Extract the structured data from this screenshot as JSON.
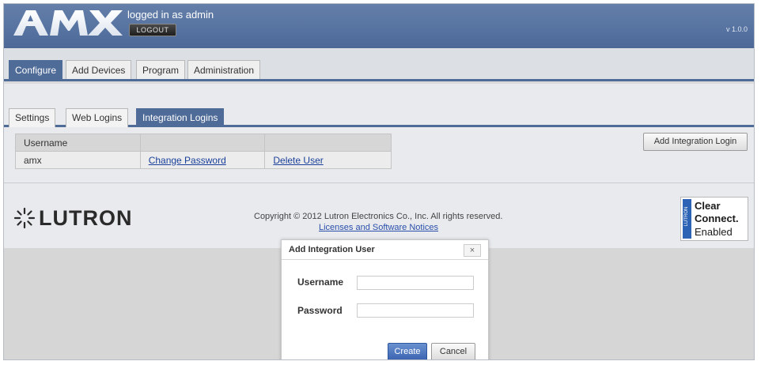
{
  "header": {
    "brand": "AMX",
    "logged_in_text": "logged in as admin",
    "logout_label": "LOGOUT",
    "version": "v 1.0.0"
  },
  "main_nav": {
    "tabs": [
      {
        "label": "Configure",
        "active": true
      },
      {
        "label": "Add Devices",
        "active": false
      },
      {
        "label": "Program",
        "active": false
      },
      {
        "label": "Administration",
        "active": false
      }
    ]
  },
  "sub_nav": {
    "tabs": [
      {
        "label": "Settings",
        "active": false
      },
      {
        "label": "Web Logins",
        "active": false
      },
      {
        "label": "Integration Logins",
        "active": true
      }
    ]
  },
  "users_table": {
    "header": "Username",
    "rows": [
      {
        "username": "amx",
        "change_password": "Change Password",
        "delete_user": "Delete User"
      }
    ]
  },
  "add_integration_login_label": "Add Integration Login",
  "footer": {
    "brand": "LUTRON",
    "copyright": "Copyright © 2012 Lutron Electronics Co., Inc. All rights reserved.",
    "licenses_link": "Licenses and Software Notices",
    "badge": {
      "strip": "LUTRON",
      "line1": "Clear",
      "line2": "Connect.",
      "line3": "Enabled"
    }
  },
  "dialog": {
    "title": "Add Integration User",
    "close_symbol": "×",
    "username_label": "Username",
    "username_value": "",
    "password_label": "Password",
    "password_value": "",
    "create_label": "Create",
    "cancel_label": "Cancel"
  },
  "colors": {
    "header_blue": "#5672a0",
    "active_tab": "#4f6b98",
    "link": "#1a3f9a",
    "create_button": "#3a62b0"
  }
}
